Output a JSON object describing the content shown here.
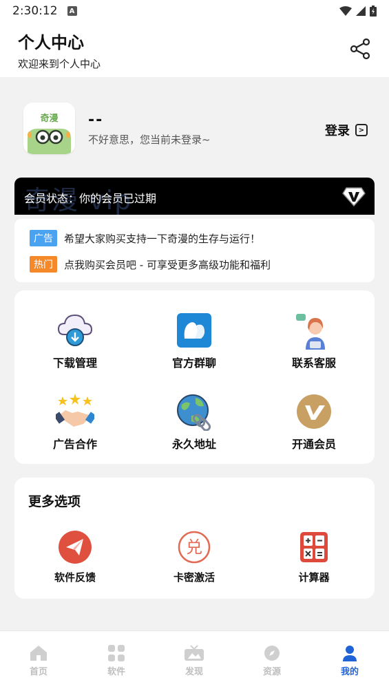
{
  "status_bar": {
    "time": "2:30:12",
    "badge": "A"
  },
  "header": {
    "title": "个人中心",
    "subtitle": "欢迎来到个人中心"
  },
  "profile": {
    "avatar_text": "奇漫",
    "username": "--",
    "hint": "不好意思，您当前未登录~",
    "login_label": "登录"
  },
  "vip": {
    "watermark": "奇漫 vip",
    "status": "会员状态：你的会员已过期"
  },
  "notices": [
    {
      "tag": "广告",
      "text": "希望大家购买支持一下奇漫的生存与运行！"
    },
    {
      "tag": "热门",
      "text": "点我购买会员吧 - 可享受更多高级功能和福利"
    }
  ],
  "grid": [
    {
      "label": "下载管理",
      "icon": "cloud-download-icon"
    },
    {
      "label": "官方群聊",
      "icon": "group-chat-icon"
    },
    {
      "label": "联系客服",
      "icon": "customer-service-icon"
    },
    {
      "label": "广告合作",
      "icon": "handshake-icon"
    },
    {
      "label": "永久地址",
      "icon": "globe-link-icon"
    },
    {
      "label": "开通会员",
      "icon": "vip-icon"
    }
  ],
  "more": {
    "title": "更多选项",
    "items": [
      {
        "label": "软件反馈",
        "icon": "send-icon"
      },
      {
        "label": "卡密激活",
        "icon": "redeem-icon",
        "glyph": "兑"
      },
      {
        "label": "计算器",
        "icon": "calculator-icon"
      }
    ]
  },
  "tabs": [
    {
      "label": "首页",
      "icon": "home-icon"
    },
    {
      "label": "软件",
      "icon": "apps-icon"
    },
    {
      "label": "发现",
      "icon": "discover-icon"
    },
    {
      "label": "资源",
      "icon": "compass-icon"
    },
    {
      "label": "我的",
      "icon": "user-icon",
      "active": true
    }
  ],
  "colors": {
    "accent": "#1f63d6",
    "ad_tag": "#4aa3f0",
    "hot_tag": "#f5892a",
    "vip_bar": "#000000"
  }
}
